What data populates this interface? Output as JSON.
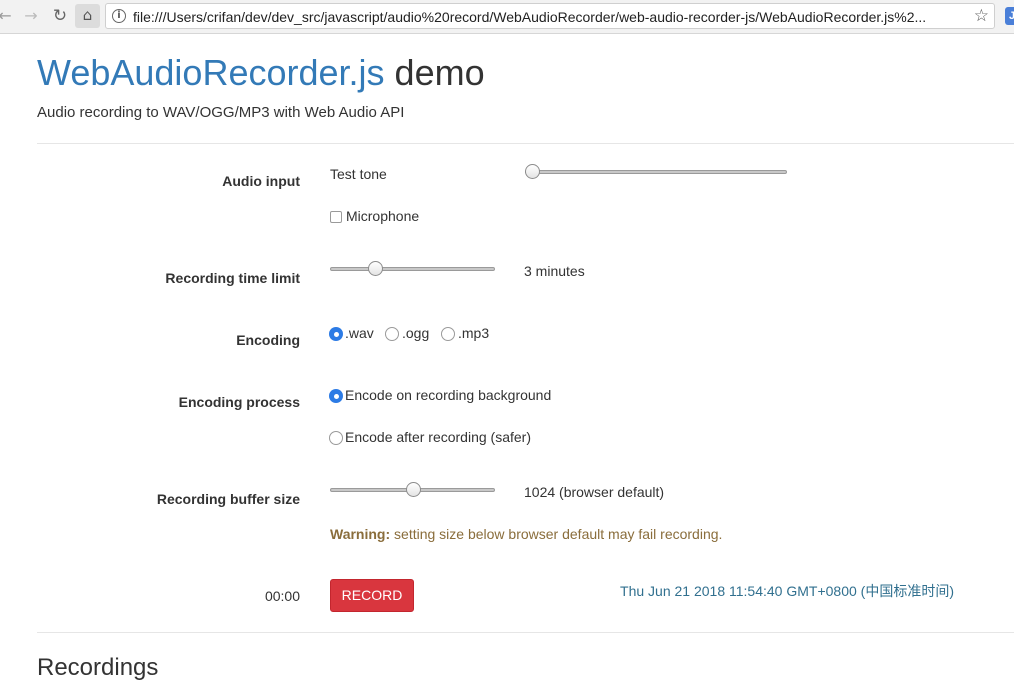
{
  "browser": {
    "url": "file:///Users/crifan/dev/dev_src/javascript/audio%20record/WebAudioRecorder/web-audio-recorder-js/WebAudioRecorder.js%2..."
  },
  "header": {
    "title_brand": "WebAudioRecorder.js",
    "title_rest": "demo",
    "subtitle": "Audio recording to WAV/OGG/MP3 with Web Audio API"
  },
  "form": {
    "audio_input": {
      "label": "Audio input",
      "test_tone_label": "Test tone",
      "test_tone_level": 0,
      "microphone_label": "Microphone",
      "microphone_checked": false
    },
    "time_limit": {
      "label": "Recording time limit",
      "value_text": "3 minutes",
      "level": 0.25
    },
    "encoding": {
      "label": "Encoding",
      "options": [
        ".wav",
        ".ogg",
        ".mp3"
      ],
      "selected": ".wav"
    },
    "encoding_process": {
      "label": "Encoding process",
      "options": [
        "Encode on recording background",
        "Encode after recording (safer)"
      ],
      "selected": "Encode on recording background"
    },
    "buffer_size": {
      "label": "Recording buffer size",
      "value_text": "1024 (browser default)",
      "level": 0.5,
      "warning_strong": "Warning:",
      "warning_text": "setting size below browser default may fail recording."
    }
  },
  "record": {
    "time": "00:00",
    "button_label": "RECORD",
    "datetime": "Thu Jun 21 2018 11:54:40 GMT+0800 (中国标准时间)"
  },
  "recordings": {
    "title": "Recordings"
  },
  "colors": {
    "brand": "#337ab7",
    "record_button": "#d9363e",
    "warning": "#8a6d3b",
    "datetime": "#31708f",
    "radio_checked": "#2c7be5"
  }
}
